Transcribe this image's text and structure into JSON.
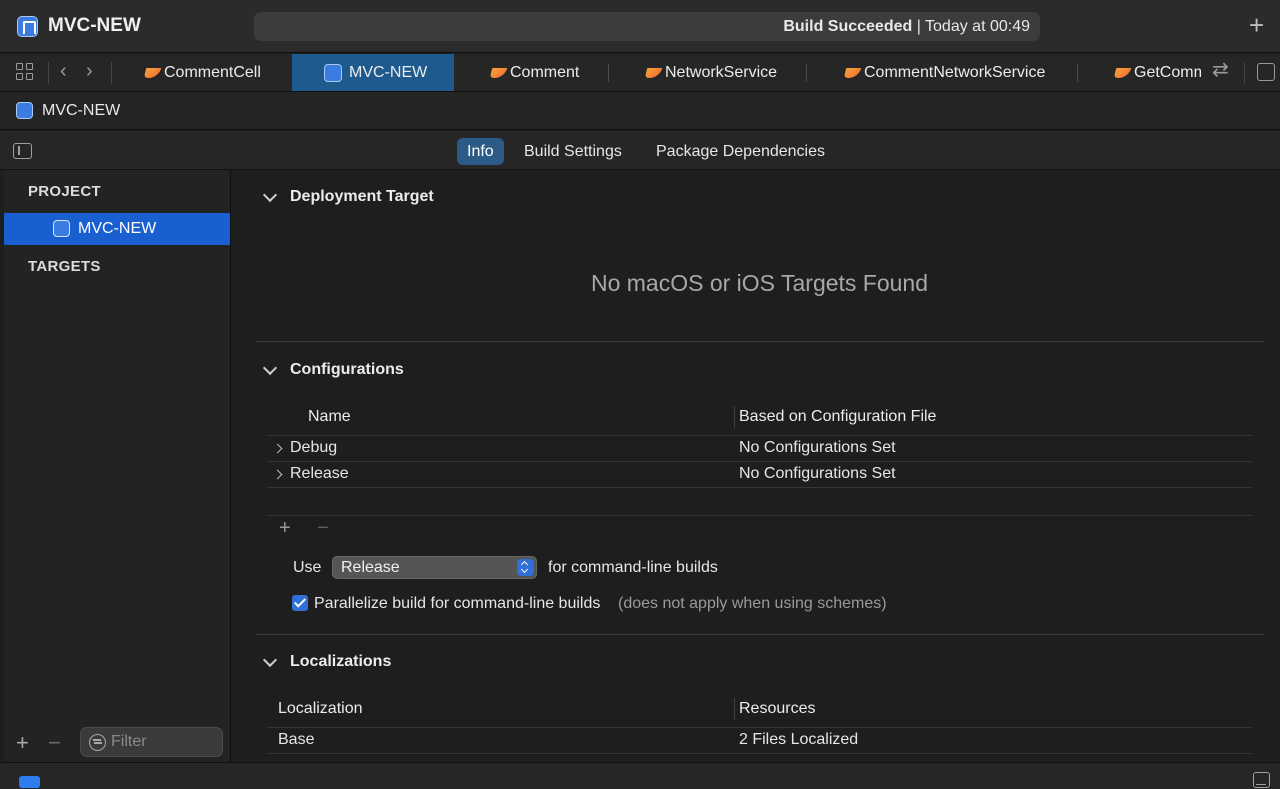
{
  "window": {
    "title": "MVC-NEW",
    "status_strong": "Build Succeeded",
    "status_rest": " | Today at 00:49"
  },
  "tabs": [
    {
      "label": "CommentCell",
      "icon": "swift-icon",
      "active": false
    },
    {
      "label": "MVC-NEW",
      "icon": "project-icon",
      "active": true
    },
    {
      "label": "Comment",
      "icon": "swift-icon",
      "active": false
    },
    {
      "label": "NetworkService",
      "icon": "swift-icon",
      "active": false
    },
    {
      "label": "CommentNetworkService",
      "icon": "swift-icon",
      "active": false
    },
    {
      "label": "GetComm",
      "icon": "swift-icon",
      "active": false
    }
  ],
  "breadcrumb": {
    "label": "MVC-NEW"
  },
  "editor_tabs": {
    "info": "Info",
    "build_settings": "Build Settings",
    "package_dependencies": "Package Dependencies"
  },
  "sidebar": {
    "project_heading": "PROJECT",
    "project_item": "MVC-NEW",
    "targets_heading": "TARGETS",
    "filter_placeholder": "Filter"
  },
  "deployment": {
    "title": "Deployment Target",
    "empty_message": "No macOS or iOS Targets Found"
  },
  "configurations": {
    "title": "Configurations",
    "col_name": "Name",
    "col_file": "Based on Configuration File",
    "rows": [
      {
        "name": "Debug",
        "file": "No Configurations Set"
      },
      {
        "name": "Release",
        "file": "No Configurations Set"
      }
    ],
    "use_label": "Use",
    "use_value": "Release",
    "use_suffix": "for command-line builds",
    "parallelize_label": "Parallelize build for command-line builds",
    "parallelize_hint": "(does not apply when using schemes)",
    "parallelize_checked": true
  },
  "localizations": {
    "title": "Localizations",
    "col_localization": "Localization",
    "col_resources": "Resources",
    "rows": [
      {
        "name": "Base",
        "resources": "2 Files Localized"
      }
    ]
  },
  "colors": {
    "accent": "#2f6fd6",
    "selection": "#1a5fd0",
    "active_tab": "#1f5a8f"
  }
}
